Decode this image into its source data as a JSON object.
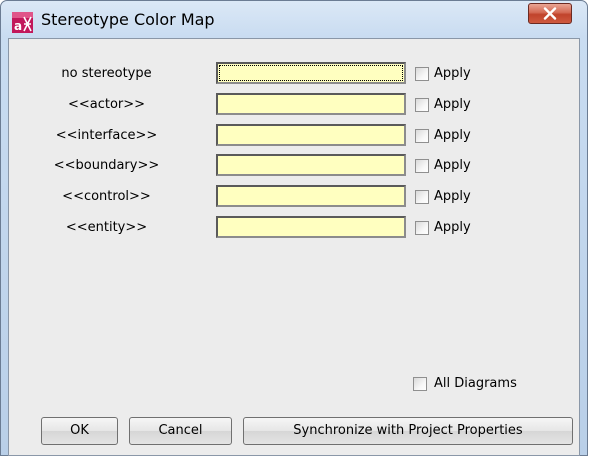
{
  "window": {
    "title": "Stereotype Color Map",
    "icon": "app-logo-icon",
    "close_icon": "close-icon"
  },
  "rows": [
    {
      "label": "no stereotype",
      "color": "#ffffc0",
      "apply_label": "Apply",
      "apply_checked": false
    },
    {
      "label": "<<actor>>",
      "color": "#ffffc0",
      "apply_label": "Apply",
      "apply_checked": false
    },
    {
      "label": "<<interface>>",
      "color": "#ffffc0",
      "apply_label": "Apply",
      "apply_checked": false
    },
    {
      "label": "<<boundary>>",
      "color": "#ffffc0",
      "apply_label": "Apply",
      "apply_checked": false
    },
    {
      "label": "<<control>>",
      "color": "#ffffc0",
      "apply_label": "Apply",
      "apply_checked": false
    },
    {
      "label": "<<entity>>",
      "color": "#ffffc0",
      "apply_label": "Apply",
      "apply_checked": false
    }
  ],
  "all_diagrams": {
    "label": "All Diagrams",
    "checked": false
  },
  "buttons": {
    "ok": "OK",
    "cancel": "Cancel",
    "sync": "Synchronize with Project Properties"
  }
}
